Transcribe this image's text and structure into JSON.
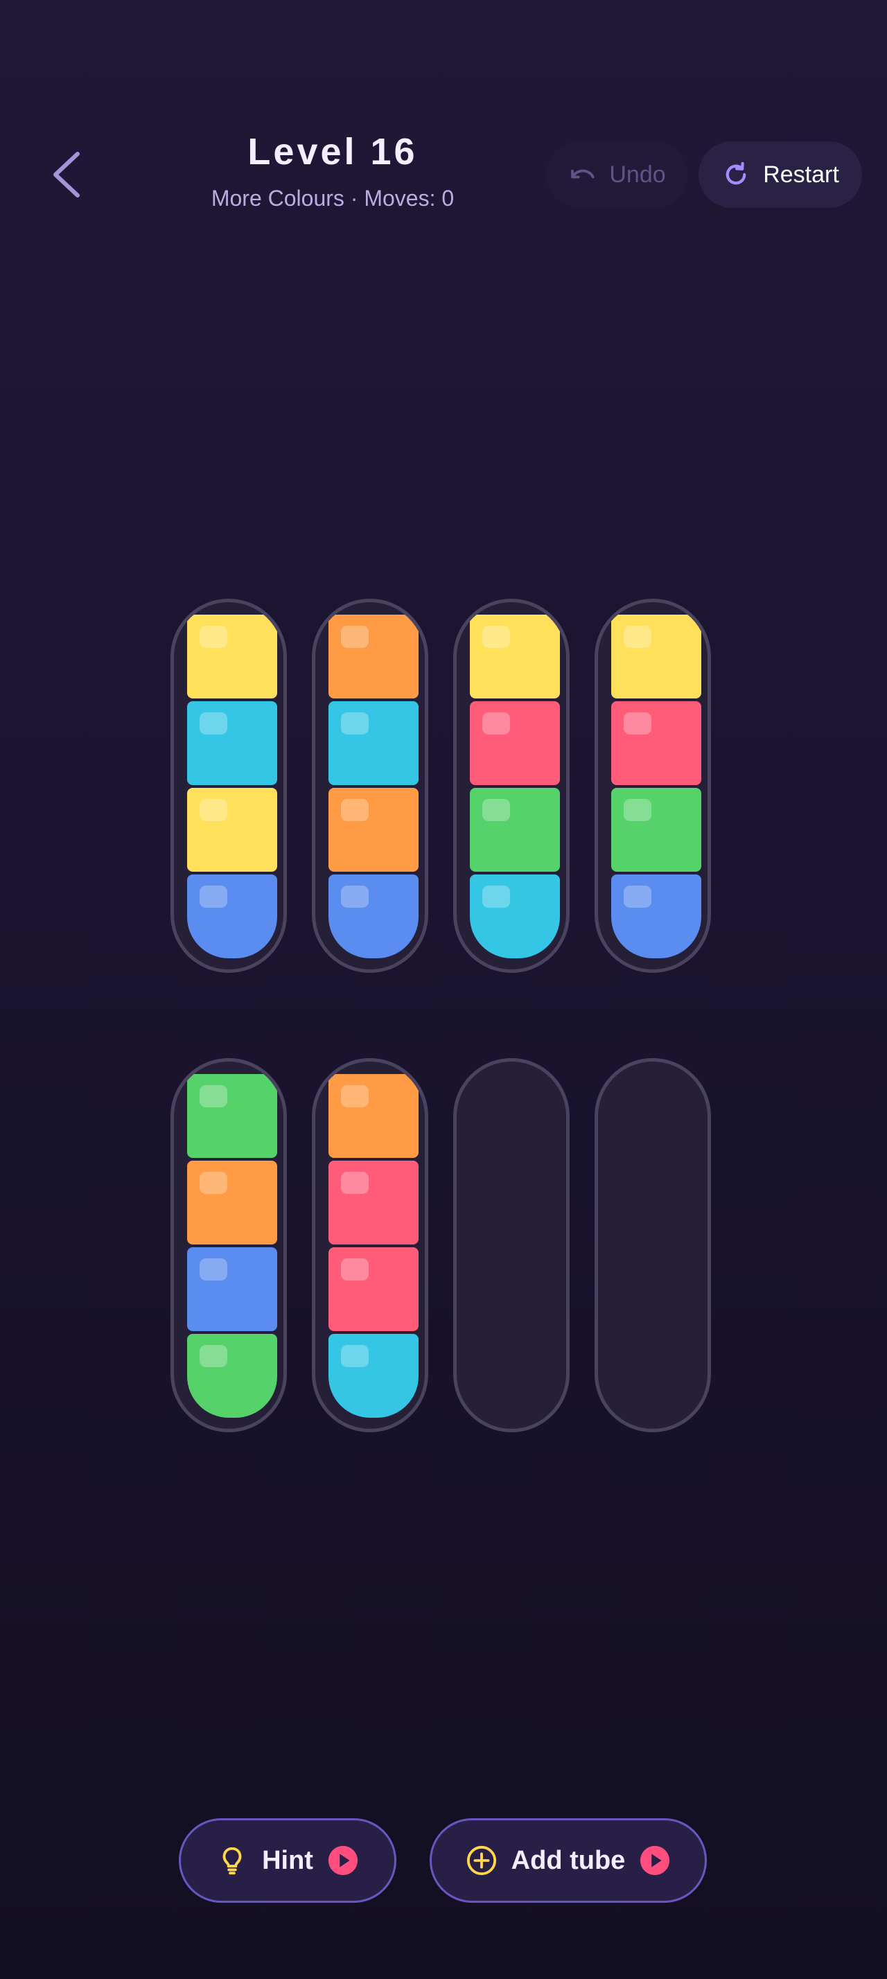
{
  "header": {
    "title": "Level 16",
    "subtitle": "More Colours · Moves: 0",
    "undo_label": "Undo",
    "restart_label": "Restart"
  },
  "colors": {
    "yellow": "#ffe05a",
    "cyan": "#35c6e6",
    "blue": "#5b8cef",
    "orange": "#ff9b45",
    "pink": "#ff5c7a",
    "green": "#56d26a",
    "accent": "#a48cff",
    "hint_bulb": "#ffd84a",
    "badge": "#ff4d7e"
  },
  "tubes": [
    [
      "yellow",
      "cyan",
      "yellow",
      "blue"
    ],
    [
      "orange",
      "cyan",
      "orange",
      "blue"
    ],
    [
      "yellow",
      "pink",
      "green",
      "cyan"
    ],
    [
      "yellow",
      "pink",
      "green",
      "blue"
    ],
    [
      "green",
      "orange",
      "blue",
      "green"
    ],
    [
      "orange",
      "pink",
      "pink",
      "cyan"
    ],
    [],
    []
  ],
  "footer": {
    "hint_label": "Hint",
    "add_tube_label": "Add tube"
  }
}
